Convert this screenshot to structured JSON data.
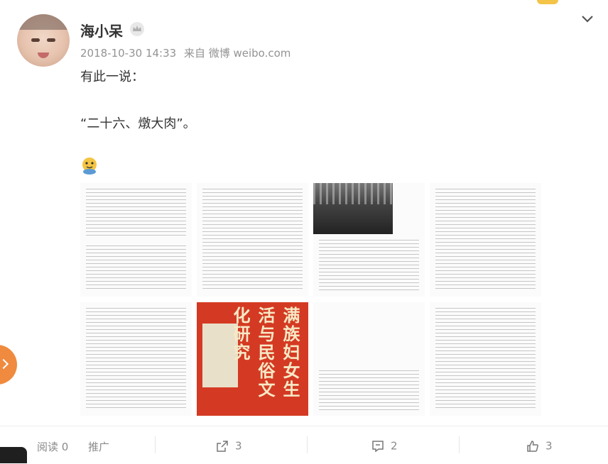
{
  "post": {
    "username": "海小呆",
    "timestamp": "2018-10-30 14:33",
    "source": "来自 微博 weibo.com",
    "text_line1": "有此一说：",
    "text_line2": "“二十六、燉大肉”。",
    "emoji_name": "doge-emoji"
  },
  "photos": {
    "book_title": "满族妇女生活与民俗文化研究",
    "items": [
      "page-scan-1",
      "page-scan-2",
      "photo-bw-crowd",
      "page-scan-4",
      "page-scan-5",
      "book-cover",
      "book-copyright",
      "page-scan-8"
    ]
  },
  "actions": {
    "read_label": "阅读",
    "read_count": "0",
    "promote_label": "推广",
    "share_count": "3",
    "comment_count": "2",
    "like_count": "3"
  },
  "colors": {
    "accent": "#f08a3e",
    "book_red": "#d43a23",
    "meta_gray": "#939393"
  }
}
